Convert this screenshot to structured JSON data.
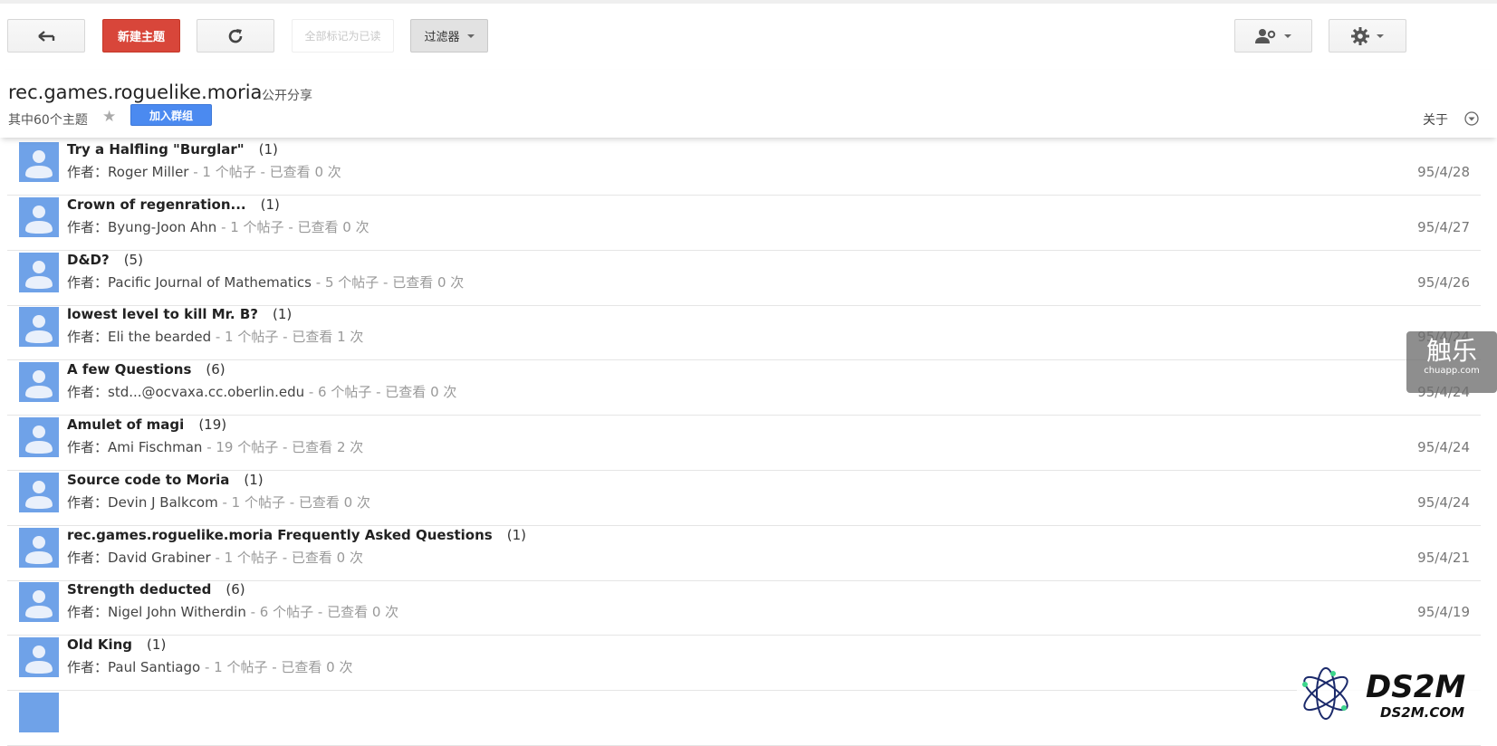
{
  "toolbar": {
    "back_icon": "back-arrow-icon",
    "new_topic_label": "新建主题",
    "refresh_icon": "refresh-icon",
    "mark_all_read_label": "全部标记为已读",
    "filter_label": "过滤器",
    "members_icon": "members-settings-icon",
    "settings_icon": "gear-icon"
  },
  "group": {
    "name": "rec.games.roguelike.moria",
    "visibility": "公开分享",
    "topic_count": "其中60个主题",
    "join_label": "加入群组",
    "about_label": "关于"
  },
  "author_prefix": "作者：",
  "topics": [
    {
      "subject": "Try a Halfling \"Burglar\"",
      "replies": "(1)",
      "author": "Roger Miller",
      "stats": " - 1 个帖子 - 已查看 0 次",
      "date": "95/4/28"
    },
    {
      "subject": "Crown of regenration...",
      "replies": "(1)",
      "author": "Byung-Joon Ahn",
      "stats": " - 1 个帖子 - 已查看 0 次",
      "date": "95/4/27"
    },
    {
      "subject": "D&D?",
      "replies": "(5)",
      "author": "Pacific Journal of Mathematics",
      "stats": " - 5 个帖子 - 已查看 0 次",
      "date": "95/4/26"
    },
    {
      "subject": "lowest level to kill Mr. B?",
      "replies": "(1)",
      "author": "Eli the bearded",
      "stats": " - 1 个帖子 - 已查看 1 次",
      "date": "95/4/24"
    },
    {
      "subject": "A few Questions",
      "replies": "(6)",
      "author": "std...@ocvaxa.cc.oberlin.edu",
      "stats": " - 6 个帖子 - 已查看 0 次",
      "date": "95/4/24"
    },
    {
      "subject": "Amulet of magi",
      "replies": "(19)",
      "author": "Ami Fischman",
      "stats": " - 19 个帖子 - 已查看 2 次",
      "date": "95/4/24"
    },
    {
      "subject": "Source code to Moria",
      "replies": "(1)",
      "author": "Devin J Balkcom",
      "stats": " - 1 个帖子 - 已查看 0 次",
      "date": "95/4/24"
    },
    {
      "subject": "rec.games.roguelike.moria Frequently Asked Questions",
      "replies": "(1)",
      "author": "David Grabiner",
      "stats": " - 1 个帖子 - 已查看 0 次",
      "date": "95/4/21"
    },
    {
      "subject": "Strength deducted",
      "replies": "(6)",
      "author": "Nigel John Witherdin",
      "stats": " - 6 个帖子 - 已查看 0 次",
      "date": "95/4/19"
    },
    {
      "subject": "Old King",
      "replies": "(1)",
      "author": "Paul Santiago",
      "stats": " - 1 个帖子 - 已查看 0 次",
      "date": ""
    }
  ],
  "watermarks": {
    "chuapp_big": "触乐",
    "chuapp_small": "chuapp.com",
    "ds2m_big": "DS2M",
    "ds2m_small": "DS2M.COM"
  },
  "colors": {
    "new_topic_red": "#d8463a",
    "join_blue": "#4b8af0",
    "avatar_blue": "#6fa2e8"
  }
}
